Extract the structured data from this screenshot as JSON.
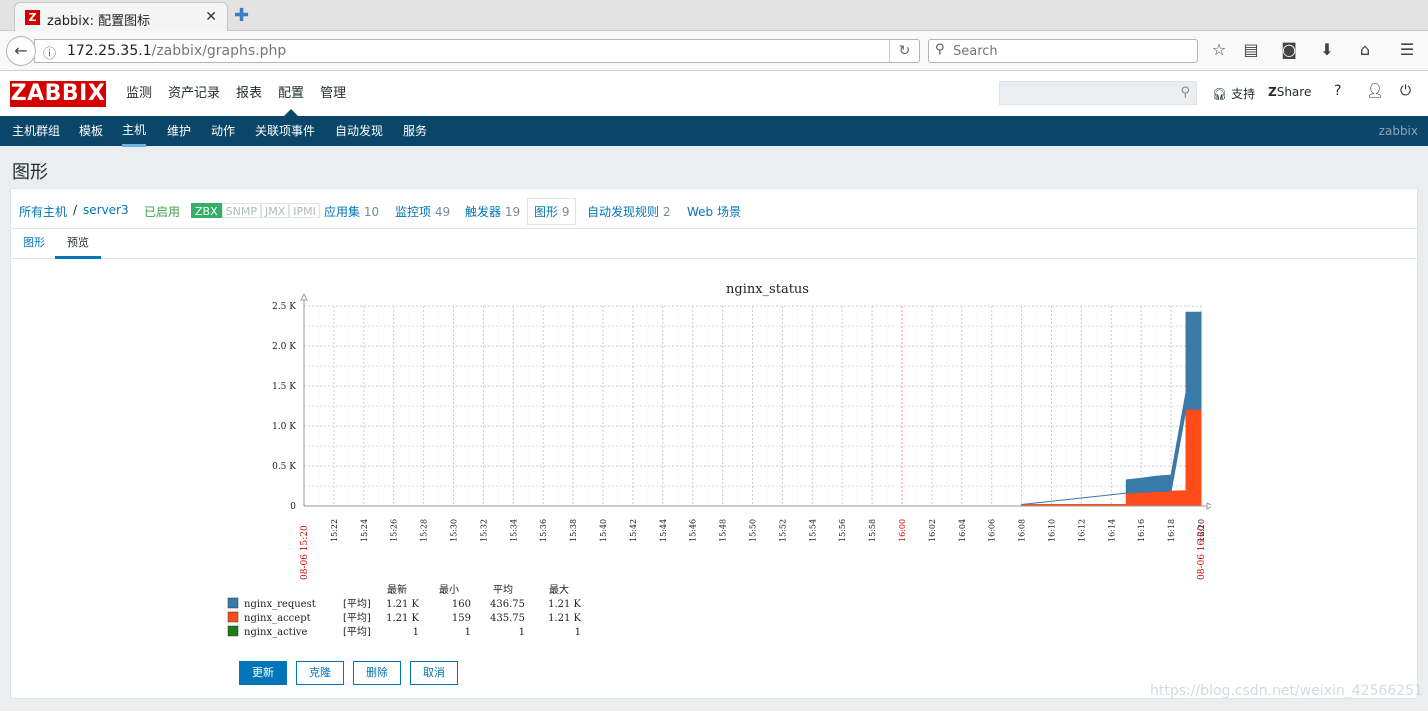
{
  "browser": {
    "tab_title": "zabbix: 配置图标",
    "tab_icon": "Z",
    "url_host": "172.25.35.1",
    "url_path": "/zabbix/graphs.php",
    "search_placeholder": "Search"
  },
  "header": {
    "logo": "ZABBIX",
    "menu": [
      "监测",
      "资产记录",
      "报表",
      "配置",
      "管理"
    ],
    "active_menu": "配置",
    "support": "支持",
    "share": "Share",
    "help": "?"
  },
  "submenu": {
    "items": [
      "主机群组",
      "模板",
      "主机",
      "维护",
      "动作",
      "关联项事件",
      "自动发现",
      "服务"
    ],
    "active": "主机",
    "brand": "zabbix"
  },
  "page_title": "图形",
  "breadcrumbs": {
    "all_hosts": "所有主机",
    "separator": "/",
    "host": "server3",
    "status": "已启用",
    "availability": [
      "ZBX",
      "SNMP",
      "JMX",
      "IPMI"
    ],
    "applications": {
      "label": "应用集",
      "count": "10"
    },
    "items": {
      "label": "监控项",
      "count": "49"
    },
    "triggers": {
      "label": "触发器",
      "count": "19"
    },
    "graphs": {
      "label": "图形",
      "count": "9"
    },
    "discovery": {
      "label": "自动发现规则",
      "count": "2"
    },
    "web": "Web 场景"
  },
  "tabs": [
    "图形",
    "预览"
  ],
  "chart_data": {
    "type": "area",
    "title": "nginx_status",
    "y_ticks": [
      "0",
      "0.5 K",
      "1.0 K",
      "1.5 K",
      "2.0 K",
      "2.5 K"
    ],
    "ylim": [
      0,
      2500
    ],
    "x_ticks": [
      "15:22",
      "15:24",
      "15:26",
      "15:28",
      "15:30",
      "15:32",
      "15:34",
      "15:36",
      "15:38",
      "15:40",
      "15:42",
      "15:44",
      "15:46",
      "15:48",
      "15:50",
      "15:52",
      "15:54",
      "15:56",
      "15:58",
      "16:00",
      "16:02",
      "16:04",
      "16:06",
      "16:08",
      "16:10",
      "16:12",
      "16:14",
      "16:16",
      "16:18",
      "16:20"
    ],
    "x_start_label": "08-06 15:20",
    "x_end_label": "08-06 16:20",
    "stacked": true,
    "grid": true,
    "series": [
      {
        "name": "nginx_active",
        "color": "#1a7c1a",
        "times": [
          "16:08",
          "16:15",
          "16:15",
          "16:19",
          "16:19",
          "16:20"
        ],
        "values": [
          1,
          1,
          1,
          1,
          1,
          1
        ]
      },
      {
        "name": "nginx_accept",
        "color": "#ff4d1a",
        "times": [
          "16:08",
          "16:15",
          "16:15",
          "16:16",
          "16:17",
          "16:18",
          "16:19",
          "16:19",
          "16:20"
        ],
        "values": [
          18,
          18,
          160,
          170,
          180,
          185,
          190,
          1210,
          1210
        ]
      },
      {
        "name": "nginx_request",
        "color": "#3a7aa8",
        "times": [
          "16:08",
          "16:15",
          "16:15",
          "16:16",
          "16:17",
          "16:18",
          "16:19",
          "16:19",
          "16:20"
        ],
        "values": [
          0,
          0,
          165,
          175,
          190,
          200,
          210,
          1210,
          1210
        ]
      }
    ],
    "legend": {
      "headers": [
        "最新",
        "最小",
        "平均",
        "最大"
      ],
      "rows": [
        {
          "name": "nginx_request",
          "color": "#3a7aa8",
          "func": "[平均]",
          "last": "1.21 K",
          "min": "160",
          "avg": "436.75",
          "max": "1.21 K"
        },
        {
          "name": "nginx_accept",
          "color": "#ff4d1a",
          "func": "[平均]",
          "last": "1.21 K",
          "min": "159",
          "avg": "435.75",
          "max": "1.21 K"
        },
        {
          "name": "nginx_active",
          "color": "#1a7c1a",
          "func": "[平均]",
          "last": "1",
          "min": "1",
          "avg": "1",
          "max": "1"
        }
      ]
    }
  },
  "buttons": {
    "update": "更新",
    "clone": "克隆",
    "delete": "删除",
    "cancel": "取消"
  },
  "watermark": "https://blog.csdn.net/weixin_42566251"
}
